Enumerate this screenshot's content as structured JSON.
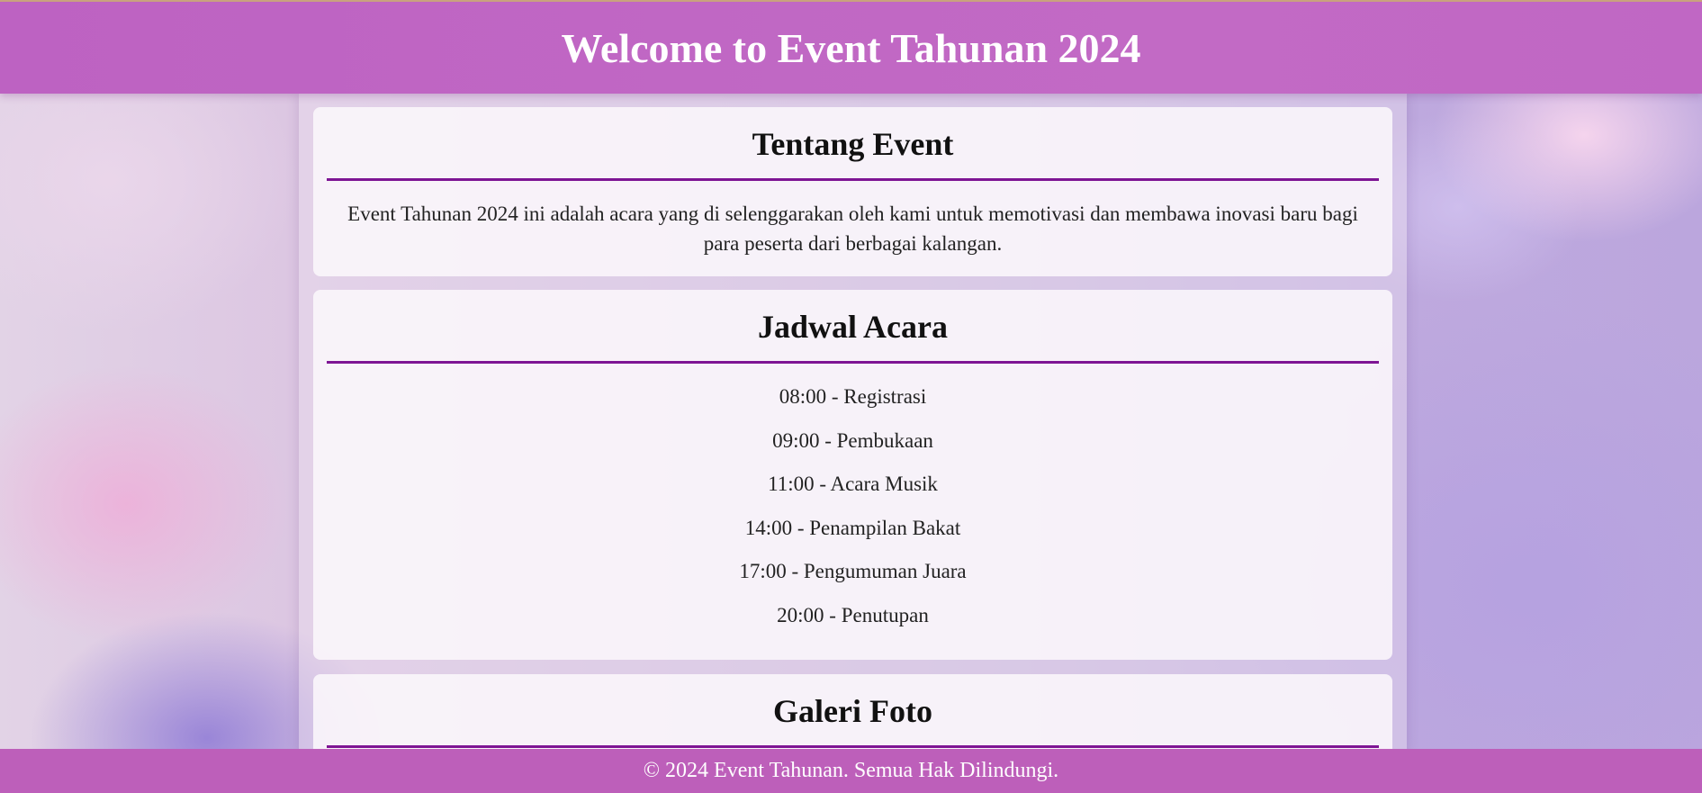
{
  "header": {
    "title": "Welcome to Event Tahunan 2024"
  },
  "about": {
    "heading": "Tentang Event",
    "text": "Event Tahunan 2024 ini adalah acara yang di selenggarakan oleh kami untuk memotivasi dan membawa inovasi baru bagi para peserta dari berbagai kalangan."
  },
  "schedule": {
    "heading": "Jadwal Acara",
    "items": [
      "08:00 - Registrasi",
      "09:00 - Pembukaan",
      "11:00 - Acara Musik",
      "14:00 - Penampilan Bakat",
      "17:00 - Pengumuman Juara",
      "20:00 - Penutupan"
    ]
  },
  "gallery": {
    "heading": "Galeri Foto"
  },
  "footer": {
    "text": "© 2024 Event Tahunan. Semua Hak Dilindungi."
  },
  "colors": {
    "header_bg": "#bd62c2",
    "footer_bg": "#bd5fba",
    "divider": "#7e1594"
  }
}
